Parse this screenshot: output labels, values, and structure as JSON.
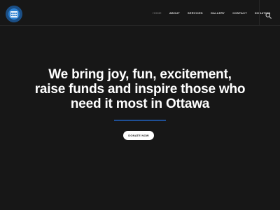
{
  "brand": {
    "logo_icon": "charity-logo-icon",
    "accent": "#1b4f86"
  },
  "nav": {
    "items": [
      {
        "label": "HOME",
        "active": true
      },
      {
        "label": "ABOUT",
        "active": false
      },
      {
        "label": "SERVICES",
        "active": false
      },
      {
        "label": "GALLERY",
        "active": false
      },
      {
        "label": "CONTACT",
        "active": false
      },
      {
        "label": "DONATION",
        "active": false
      }
    ],
    "search_icon": "search-icon"
  },
  "hero": {
    "lines": [
      "We bring joy, fun, excitement,",
      "raise funds and inspire those who",
      "need it most in Ottawa"
    ],
    "button_label": "DONATE NOW",
    "divider_color": "#1e4f96",
    "background": "#171717"
  }
}
